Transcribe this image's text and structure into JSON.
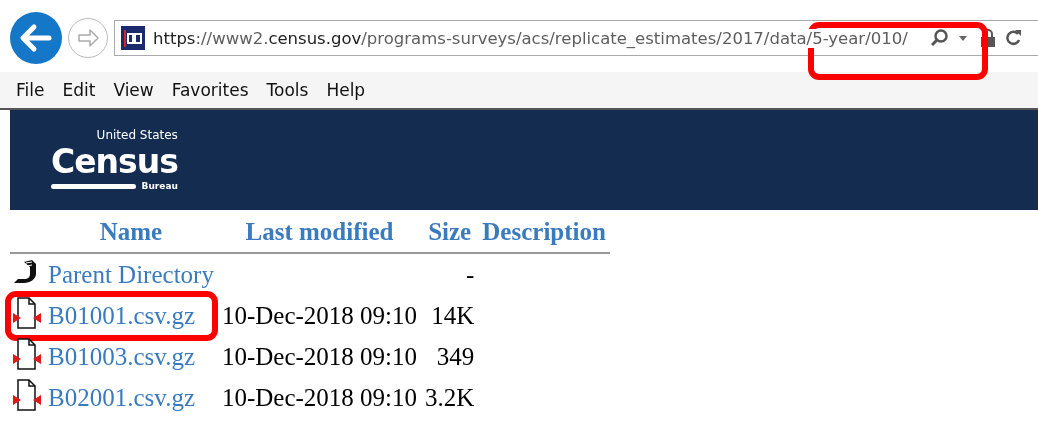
{
  "browser": {
    "address": {
      "parts": [
        {
          "text": "https",
          "strong": true
        },
        {
          "text": "://www2.",
          "strong": false
        },
        {
          "text": "census.gov",
          "strong": true
        },
        {
          "text": "/programs-surveys/acs/replicate_estimates/2017/data/5-year/010/",
          "strong": false
        }
      ],
      "highlighted": true
    },
    "menu": [
      "File",
      "Edit",
      "View",
      "Favorites",
      "Tools",
      "Help"
    ]
  },
  "banner": {
    "logo": {
      "top": "United States",
      "main": "Census",
      "bottom": "Bureau"
    }
  },
  "listing": {
    "columns": [
      "Name",
      "Last modified",
      "Size",
      "Description"
    ],
    "rows": [
      {
        "kind": "parent",
        "name": "Parent Directory",
        "modified": "",
        "size": "-",
        "highlighted": false
      },
      {
        "kind": "file",
        "name": "B01001.csv.gz",
        "modified": "10-Dec-2018 09:10",
        "size": "14K",
        "highlighted": true
      },
      {
        "kind": "file",
        "name": "B01003.csv.gz",
        "modified": "10-Dec-2018 09:10",
        "size": "349",
        "highlighted": false
      },
      {
        "kind": "file",
        "name": "B02001.csv.gz",
        "modified": "10-Dec-2018 09:10",
        "size": "3.2K",
        "highlighted": false
      }
    ]
  }
}
